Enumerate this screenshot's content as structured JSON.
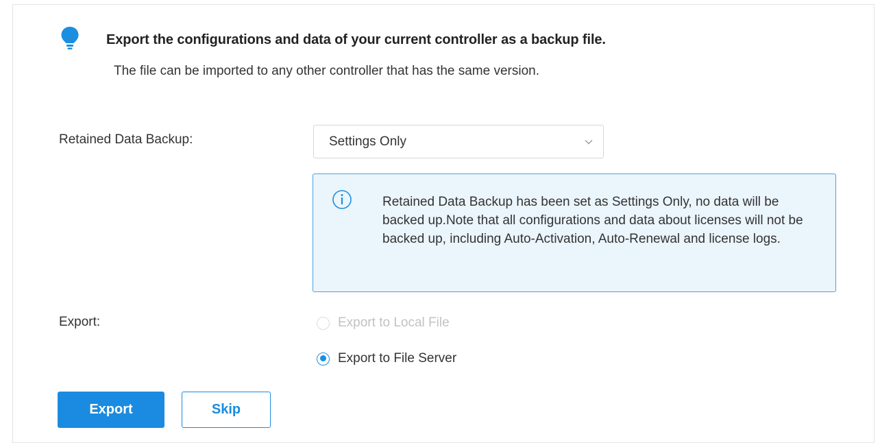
{
  "header": {
    "icon": "lightbulb-icon",
    "title": "Export the configurations and data of your current controller as a backup file.",
    "subtitle": "The file can be imported to any other controller that has the same version."
  },
  "retained_backup": {
    "label": "Retained Data Backup:",
    "selected_value": "Settings Only"
  },
  "info": {
    "icon": "info-icon",
    "text": "Retained Data Backup has been set as Settings Only, no data will be backed up.Note that all configurations and data about licenses will not be backed up, including Auto-Activation, Auto-Renewal and license logs."
  },
  "export": {
    "label": "Export:",
    "options": [
      {
        "label": "Export to Local File",
        "checked": false,
        "disabled": true
      },
      {
        "label": "Export to File Server",
        "checked": true,
        "disabled": false
      }
    ]
  },
  "actions": {
    "export_label": "Export",
    "skip_label": "Skip"
  },
  "colors": {
    "accent": "#1a8be0",
    "info_border": "#4aa4e0",
    "info_background": "#ebf5fc"
  }
}
